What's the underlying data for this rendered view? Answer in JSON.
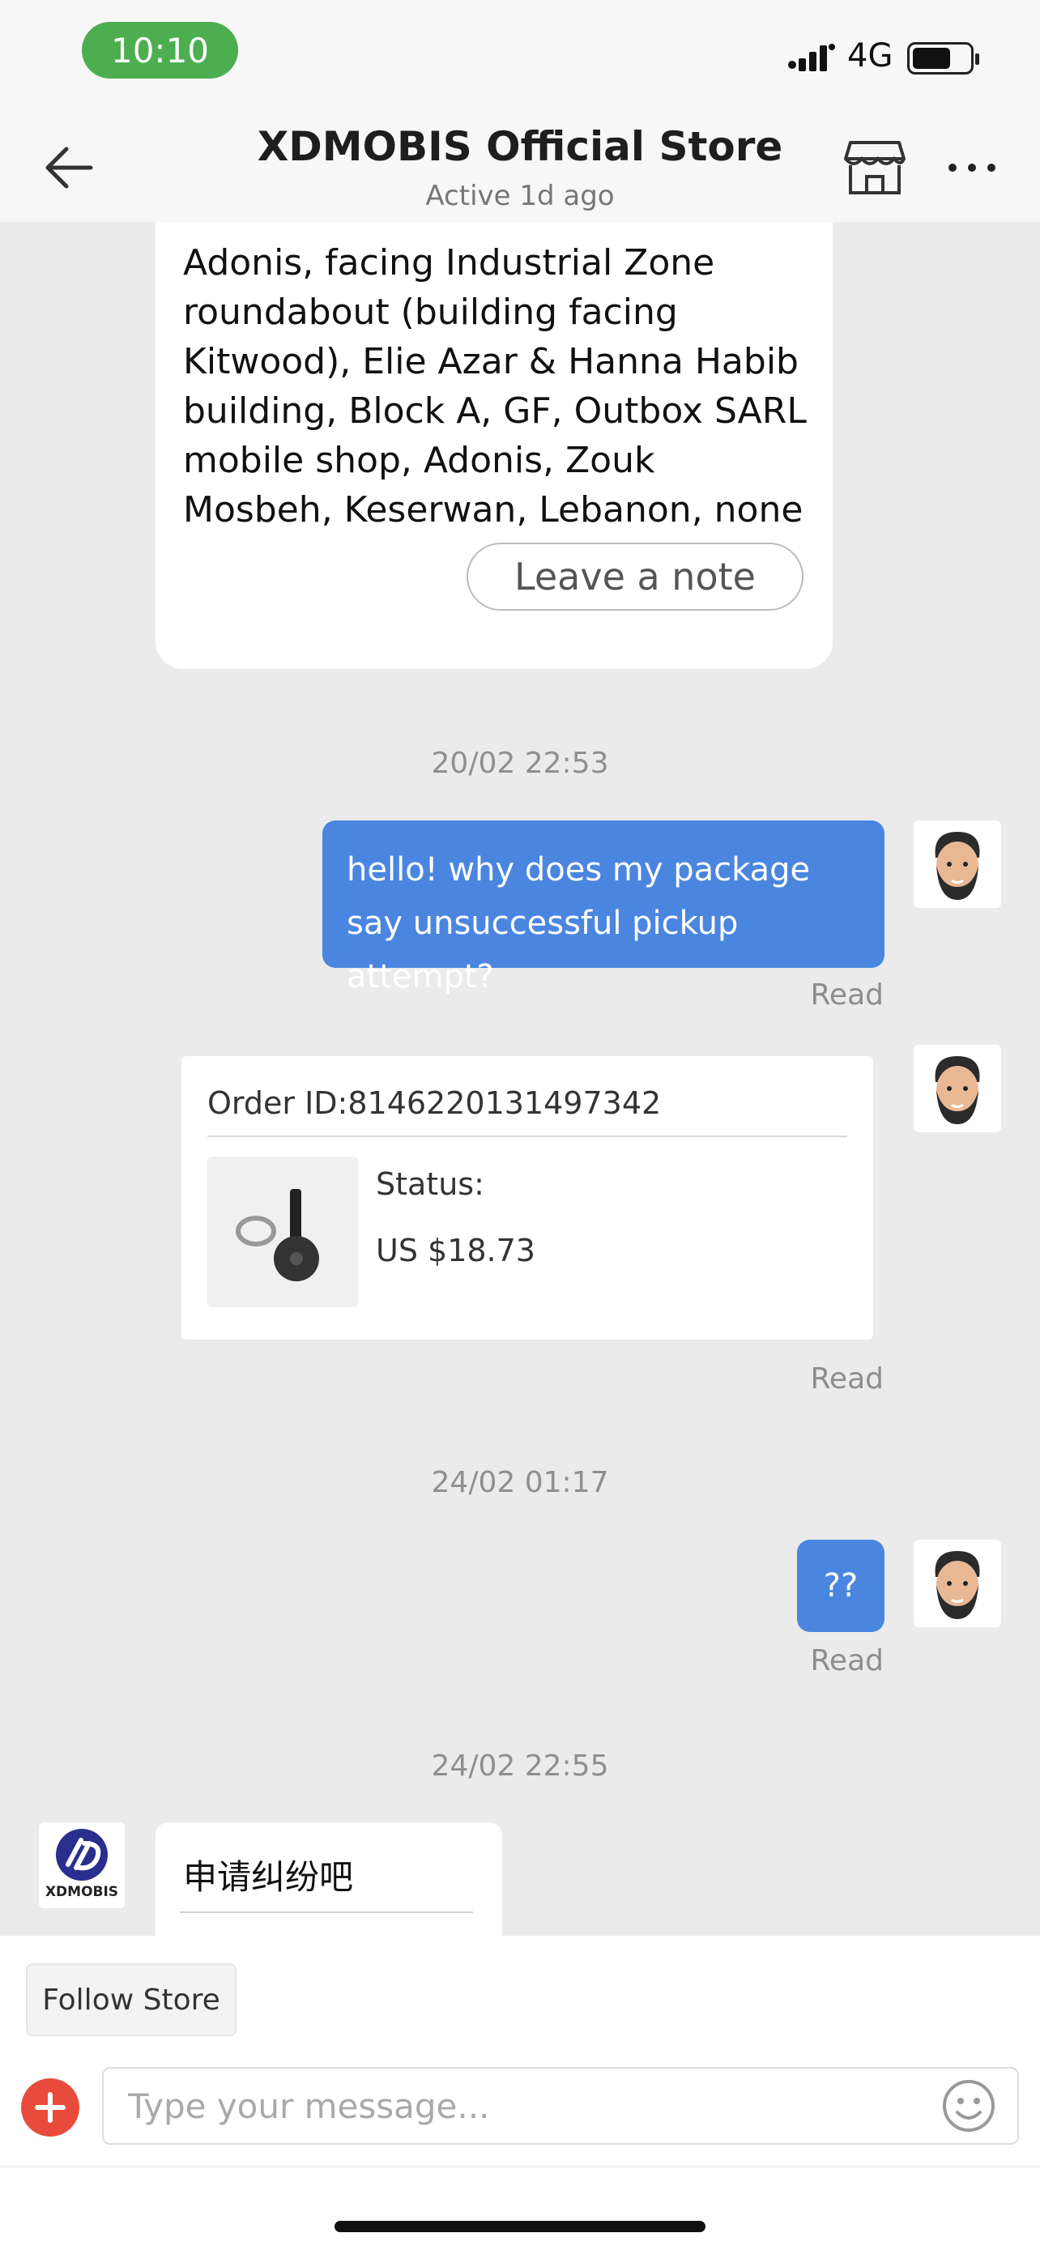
{
  "status_bar": {
    "time": "10:10",
    "network": "4G"
  },
  "header": {
    "title": "XDMOBIS Official Store",
    "subtitle": "Active 1d ago"
  },
  "address_card": {
    "text": "Adonis, facing Industrial Zone roundabout (building facing Kitwood), Elie Azar & Hanna Habib building, Block A, GF, Outbox SARL mobile shop, Adonis, Zouk Mosbeh, Keserwan, Lebanon, none",
    "note_button": "Leave a note"
  },
  "messages": [
    {
      "type": "timestamp",
      "text": "20/02 22:53"
    },
    {
      "type": "outgoing",
      "text": "hello! why does my package say unsuccessful pickup attempt?",
      "status": "Read"
    },
    {
      "type": "order",
      "order_id": "Order ID:8146220131497342",
      "status_label": "Status:",
      "price": "US $18.73",
      "status": "Read"
    },
    {
      "type": "timestamp",
      "text": "24/02 01:17"
    },
    {
      "type": "outgoing",
      "text": "??",
      "status": "Read"
    },
    {
      "type": "timestamp",
      "text": "24/02 22:55"
    },
    {
      "type": "incoming",
      "text": "申请纠纷吧",
      "sender_logo": "XDMOBIS"
    }
  ],
  "bottom": {
    "follow_label": "Follow Store",
    "input_placeholder": "Type your message..."
  },
  "colors": {
    "outgoing_bubble": "#4a86df",
    "time_pill": "#4cae4f",
    "add_button": "#e84b3c"
  }
}
